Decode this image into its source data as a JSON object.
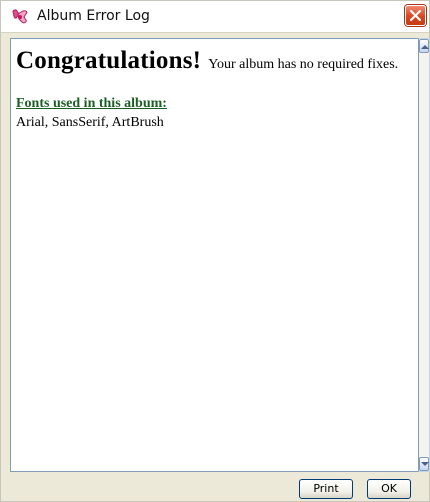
{
  "window": {
    "title": "Album Error Log",
    "icon": "album-icon",
    "close_icon": "close-icon"
  },
  "content": {
    "headline": "Congratulations!",
    "message": "Your album has no required fixes.",
    "fonts_heading": "Fonts used in this album:",
    "fonts_list": "Arial, SansSerif, ArtBrush"
  },
  "scrollbar": {
    "up_icon": "scroll-up-arrow-icon",
    "down_icon": "scroll-down-arrow-icon"
  },
  "buttons": {
    "print_label": "Print",
    "ok_label": "OK"
  },
  "colors": {
    "fonts_heading": "#1c5f23",
    "close_button": "#d9461f",
    "button_border": "#003c74"
  }
}
